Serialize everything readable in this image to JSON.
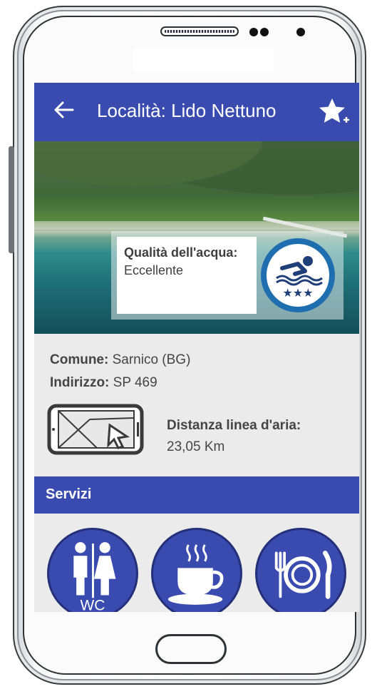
{
  "colors": {
    "primary": "#3a4bb0",
    "text": "#454545",
    "screen_bg": "#ebebeb",
    "accent_badge": "#1f6fb0"
  },
  "appbar": {
    "title": "Località: Lido Nettuno",
    "back_icon": "arrow-left-icon",
    "favorite_icon": "star-add-icon"
  },
  "water_quality": {
    "label": "Qualità dell'acqua:",
    "value": "Eccellente",
    "icon": "swimmer-three-stars-icon"
  },
  "location": {
    "comune_label": "Comune:",
    "comune_value": "Sarnico (BG)",
    "indirizzo_label": "Indirizzo:",
    "indirizzo_value": "SP 469"
  },
  "distance": {
    "label": "Distanza linea d'aria:",
    "value": "23,05 Km",
    "icon": "map-navigation-icon"
  },
  "services": {
    "title": "Servizi",
    "items": [
      {
        "icon": "wc-icon",
        "text": "WC"
      },
      {
        "icon": "coffee-cup-icon"
      },
      {
        "icon": "restaurant-icon"
      }
    ]
  }
}
